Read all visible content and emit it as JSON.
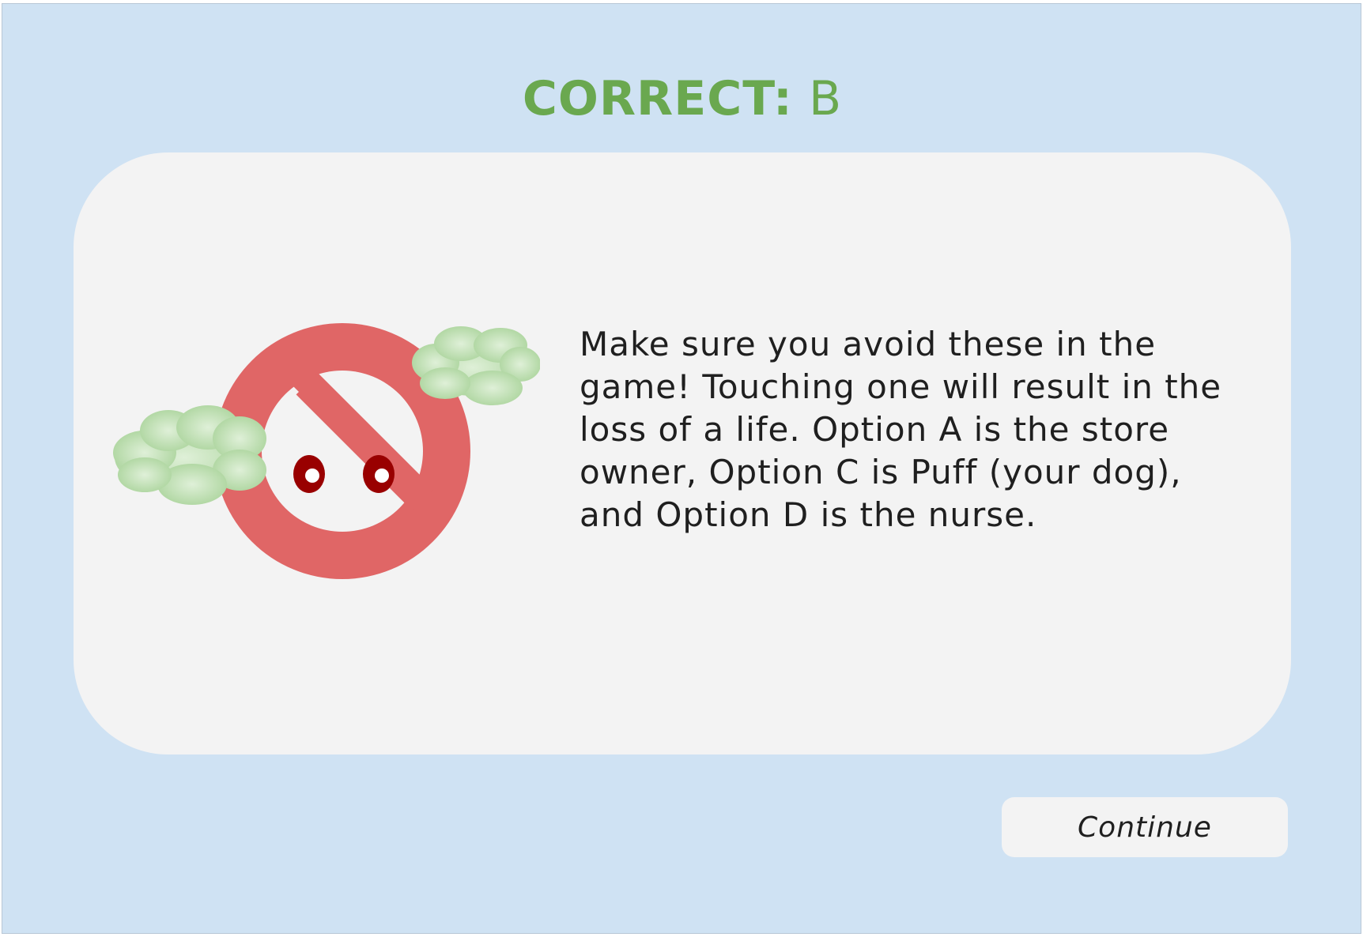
{
  "result": {
    "label": "CORRECT:",
    "answer": "B"
  },
  "card": {
    "explanation": "Make sure you avoid these in the game! Touching one will result in the loss of a life. Option A is the store owner, Option C is Puff (your dog), and Option D is the nurse.",
    "illustration": {
      "icon": "no-entry-ghost-with-clouds-icon"
    }
  },
  "actions": {
    "continue_label": "Continue"
  },
  "colors": {
    "background": "#cfe2f3",
    "card": "#f3f3f3",
    "correct_text": "#6aa84f",
    "prohibition_sign": "#e06666",
    "eyes": "#990000",
    "clouds": "#b6d7a8"
  }
}
